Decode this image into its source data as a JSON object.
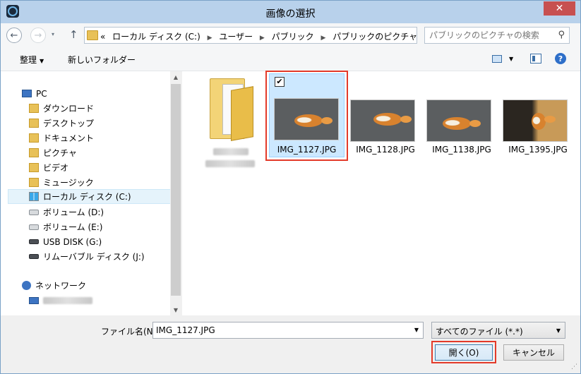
{
  "window": {
    "title": "画像の選択",
    "close": "✕"
  },
  "nav": {
    "back_icon": "←",
    "forward_icon": "→",
    "recent_icon": "▾",
    "up_icon": "↑",
    "breadcrumb": [
      "«",
      "ローカル ディスク (C:)",
      "ユーザー",
      "パブリック",
      "パブリックのピクチャ"
    ],
    "refresh_icon": "↻",
    "search_placeholder": "パブリックのピクチャの検索",
    "search_icon": "⚲"
  },
  "toolbar": {
    "organize": "整理",
    "new_folder": "新しいフォルダー",
    "help": "?"
  },
  "sidebar": {
    "items": [
      {
        "label": "PC",
        "icon": "pc"
      },
      {
        "label": "ダウンロード",
        "icon": "folder"
      },
      {
        "label": "デスクトップ",
        "icon": "folder"
      },
      {
        "label": "ドキュメント",
        "icon": "folder"
      },
      {
        "label": "ピクチャ",
        "icon": "folder"
      },
      {
        "label": "ビデオ",
        "icon": "folder"
      },
      {
        "label": "ミュージック",
        "icon": "folder"
      },
      {
        "label": "ローカル ディスク (C:)",
        "icon": "win"
      },
      {
        "label": "ボリューム (D:)",
        "icon": "drive"
      },
      {
        "label": "ボリューム (E:)",
        "icon": "drive"
      },
      {
        "label": "USB DISK (G:)",
        "icon": "drive-dark"
      },
      {
        "label": "リムーバブル ディスク (J:)",
        "icon": "drive-dark"
      },
      {
        "label": "ネットワーク",
        "icon": "net"
      }
    ]
  },
  "files": [
    {
      "name": "IMG_1127.JPG",
      "selected": true,
      "checked": "✔"
    },
    {
      "name": "IMG_1128.JPG"
    },
    {
      "name": "IMG_1138.JPG"
    },
    {
      "name": "IMG_1395.JPG"
    }
  ],
  "bottom": {
    "filename_label": "ファイル名(N):",
    "filename_value": "IMG_1127.JPG",
    "filter": "すべてのファイル (*.*)",
    "open": "開く(O)",
    "cancel": "キャンセル"
  },
  "colors": {
    "titlebar": "#b8d1eb",
    "close": "#c75050",
    "selection": "#cce8ff",
    "highlight": "#e33a2a"
  }
}
